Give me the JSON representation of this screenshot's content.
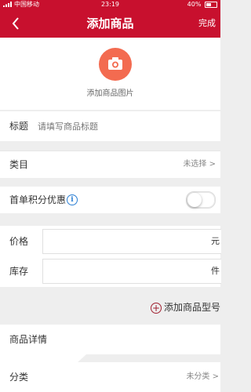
{
  "status_bar": {
    "carrier": "中国移动",
    "time": "23:19",
    "battery": "40%"
  },
  "nav": {
    "title": "添加商品",
    "done_label": "完成"
  },
  "photo": {
    "label": "添加商品图片"
  },
  "form": {
    "title_label": "标题",
    "title_placeholder": "请填写商品标题",
    "category_label": "类目",
    "category_value": "未选择 >",
    "points_label": "首单积分优惠",
    "points_info": "i",
    "points_toggle_on": false,
    "price_label": "价格",
    "price_unit": "元",
    "stock_label": "库存",
    "stock_unit": "件",
    "add_model_label": "添加商品型号",
    "details_label": "商品详情",
    "classify_label": "分类",
    "classify_value": "未分类 >"
  },
  "colors": {
    "brand_red": "#c8102e",
    "camera_orange": "#f36b50",
    "info_blue": "#2a7fd4"
  }
}
